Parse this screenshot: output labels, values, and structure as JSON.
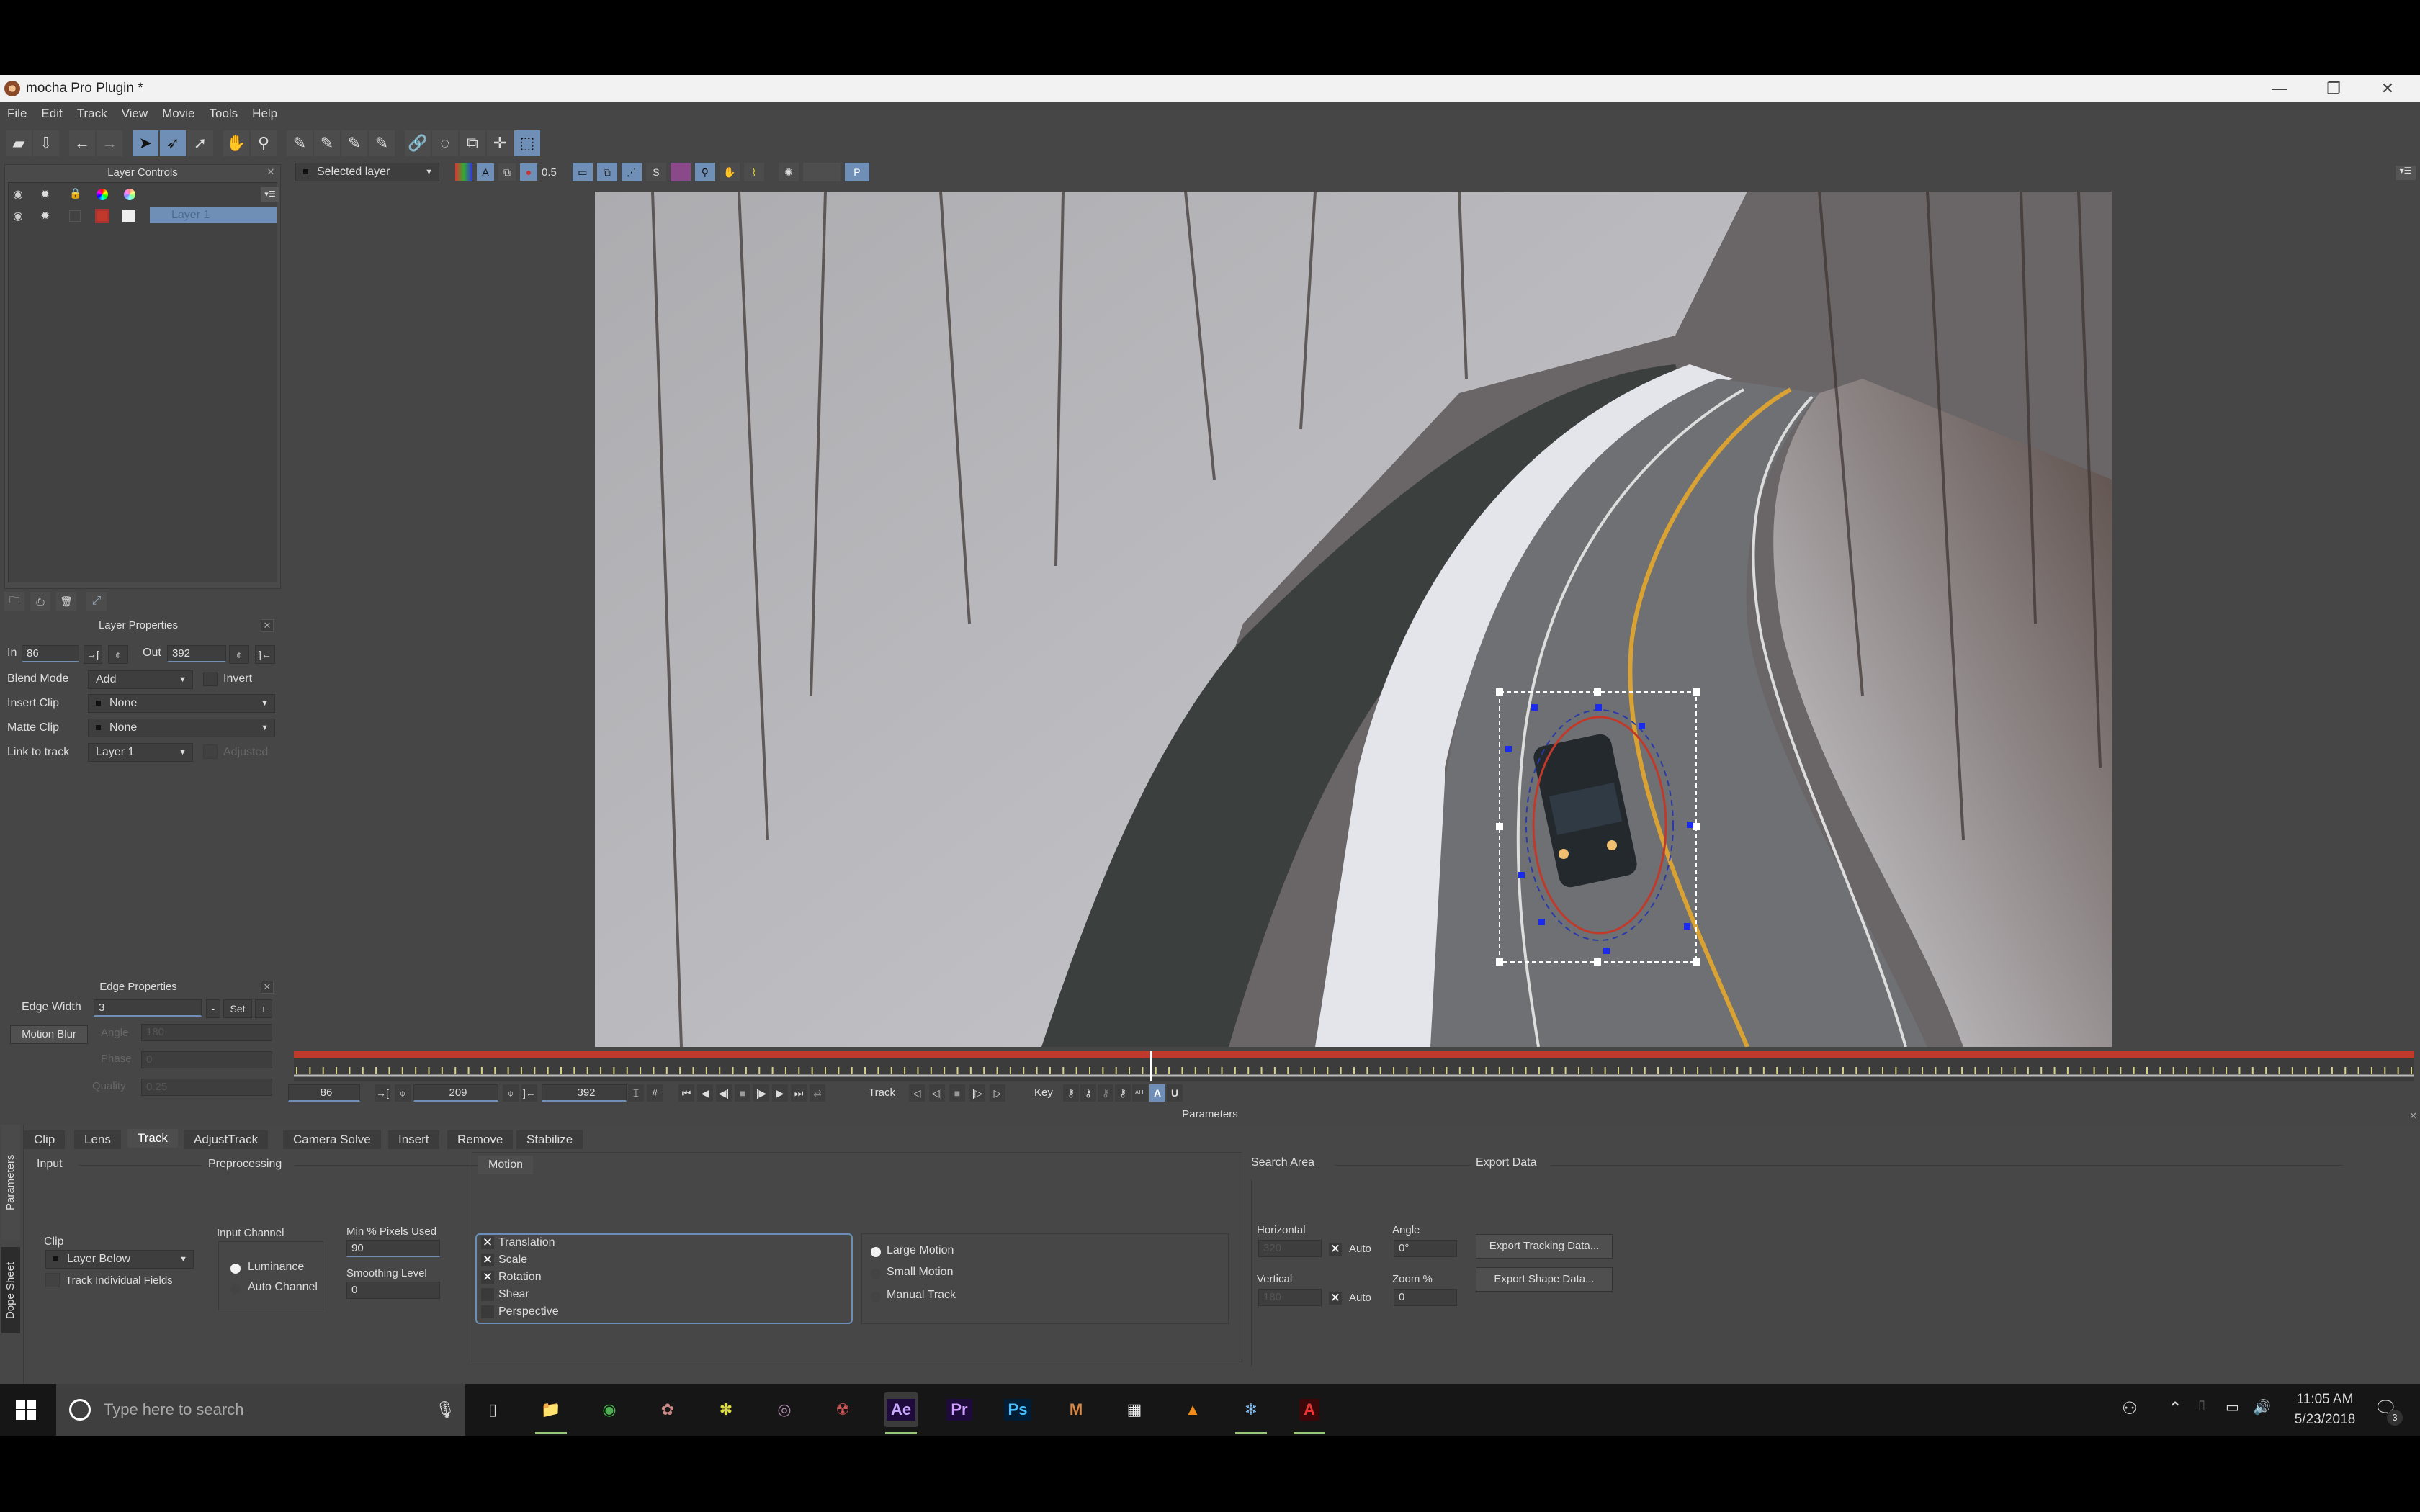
{
  "window": {
    "title": "mocha Pro Plugin *",
    "controls": {
      "minimize": "—",
      "maximize": "❐",
      "close": "✕"
    }
  },
  "menu": [
    "File",
    "Edit",
    "Track",
    "View",
    "Movie",
    "Tools",
    "Help"
  ],
  "toolbar": {
    "icons": [
      "open-folder-icon",
      "save-icon",
      "undo-arrow-icon",
      "redo-arrow-icon",
      "select-pointer-icon",
      "select-bezier-pointer-icon",
      "add-point-pointer-icon",
      "hand-pan-icon",
      "zoom-magnifier-icon",
      "xspline-pen-icon",
      "add-xspline-pen-icon",
      "bezier-pen-icon",
      "add-bezier-pen-icon",
      "link-icon",
      "rotate-lasso-icon",
      "scale-icon",
      "move-icon",
      "surface-select-icon"
    ],
    "view_selector": "Selected layer",
    "opacity_value": "0.5",
    "view_icons": [
      "color-channels-icon",
      "alpha-icon",
      "overlay-icon",
      "matte-icon",
      "show-image-icon",
      "show-layers-icon",
      "show-splines-icon",
      "surface-icon",
      "grid-icon",
      "magnifier-icon",
      "stabilize-hand-icon",
      "trace-icon",
      "brightness-icon",
      "proxy-icon"
    ],
    "proxy_label": "P"
  },
  "layer_controls": {
    "title": "Layer Controls",
    "header_icons": [
      "visibility-eye-icon",
      "cog-icon",
      "lock-icon",
      "color-wheel-icon",
      "matte-color-icon"
    ],
    "layers": [
      {
        "name": "Layer 1",
        "color": "#c0392b",
        "selected": true
      }
    ],
    "footer_icons": [
      "new-folder-icon",
      "new-layer-icon",
      "trash-icon",
      "expand-icon"
    ]
  },
  "layer_properties": {
    "title": "Layer Properties",
    "in_label": "In",
    "in_value": "86",
    "out_label": "Out",
    "out_value": "392",
    "blend_mode_label": "Blend Mode",
    "blend_mode_value": "Add",
    "invert_label": "Invert",
    "insert_clip_label": "Insert Clip",
    "insert_clip_value": "None",
    "matte_clip_label": "Matte Clip",
    "matte_clip_value": "None",
    "link_to_track_label": "Link to track",
    "link_to_track_value": "Layer 1",
    "adjusted_label": "Adjusted"
  },
  "edge_properties": {
    "title": "Edge Properties",
    "edge_width_label": "Edge Width",
    "edge_width_value": "3",
    "minus": "-",
    "set": "Set",
    "plus": "+",
    "motion_blur_label": "Motion Blur",
    "angle_label": "Angle",
    "angle_value": "180",
    "phase_label": "Phase",
    "phase_value": "0",
    "quality_label": "Quality",
    "quality_value": "0.25"
  },
  "timeline": {
    "in_frame": "86",
    "current_frame": "209",
    "out_frame": "392",
    "playhead_fraction": 0.404,
    "track_label": "Track",
    "key_label": "Key",
    "key_all_label": "ALL",
    "auto_key_label": "A",
    "u_label": "U"
  },
  "parameters": {
    "title": "Parameters",
    "side_tabs": [
      "Parameters",
      "Dope Sheet"
    ],
    "tabs": [
      "Clip",
      "Lens",
      "Track",
      "AdjustTrack",
      "Camera Solve",
      "Insert",
      "Remove",
      "Stabilize"
    ],
    "active_tab": "Track",
    "input": {
      "title": "Input",
      "clip_label": "Clip",
      "clip_value": "Layer Below",
      "track_fields_label": "Track Individual Fields"
    },
    "preprocessing": {
      "title": "Preprocessing",
      "input_channel_label": "Input Channel",
      "channels": [
        {
          "label": "Luminance",
          "selected": true
        },
        {
          "label": "Auto Channel",
          "selected": false
        }
      ],
      "min_pixels_label": "Min % Pixels Used",
      "min_pixels_value": "90",
      "smoothing_label": "Smoothing Level",
      "smoothing_value": "0"
    },
    "motion": {
      "title": "Motion",
      "types": [
        {
          "label": "Translation",
          "checked": true
        },
        {
          "label": "Scale",
          "checked": true
        },
        {
          "label": "Rotation",
          "checked": true
        },
        {
          "label": "Shear",
          "checked": false
        },
        {
          "label": "Perspective",
          "checked": false
        }
      ],
      "modes": [
        {
          "label": "Large Motion",
          "selected": true
        },
        {
          "label": "Small Motion",
          "selected": false
        },
        {
          "label": "Manual Track",
          "selected": false
        }
      ]
    },
    "search_area": {
      "title": "Search Area",
      "horizontal_label": "Horizontal",
      "horizontal_value": "320",
      "vertical_label": "Vertical",
      "vertical_value": "180",
      "auto_label": "Auto",
      "angle_label": "Angle",
      "angle_value": "0°",
      "zoom_label": "Zoom %",
      "zoom_value": "0"
    },
    "export_data": {
      "title": "Export Data",
      "export_tracking": "Export Tracking Data...",
      "export_shape": "Export Shape Data..."
    }
  },
  "taskbar": {
    "search_placeholder": "Type here to search",
    "apps": [
      {
        "name": "task-view",
        "label": "▯"
      },
      {
        "name": "file-explorer",
        "label": "📁",
        "running": true
      },
      {
        "name": "chrome",
        "label": "◉"
      },
      {
        "name": "davinci-resolve",
        "label": "✿"
      },
      {
        "name": "fusion",
        "label": "✽"
      },
      {
        "name": "media-encoder",
        "label": "◎"
      },
      {
        "name": "nuke",
        "label": "☢"
      },
      {
        "name": "after-effects",
        "label": "Ae",
        "running": true,
        "active": true
      },
      {
        "name": "premiere-pro",
        "label": "Pr"
      },
      {
        "name": "photoshop",
        "label": "Ps"
      },
      {
        "name": "magic-bullet",
        "label": "M"
      },
      {
        "name": "calculator",
        "label": "▦"
      },
      {
        "name": "vlc",
        "label": "▲"
      },
      {
        "name": "snowflake-app",
        "label": "❄",
        "running": true
      },
      {
        "name": "acrobat",
        "label": "A",
        "running": true
      }
    ],
    "time": "11:05 AM",
    "date": "5/23/2018",
    "notifications_count": "3"
  }
}
